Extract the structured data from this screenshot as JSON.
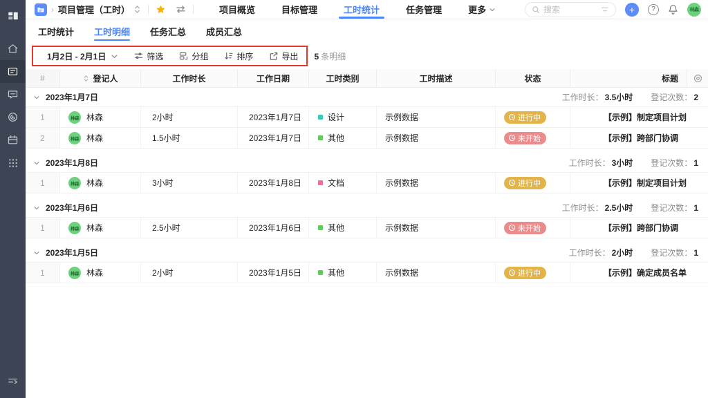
{
  "colors": {
    "accent_blue": "#4a86f8",
    "sidebar_bg": "#3d4554",
    "annotation_red": "#e6392e",
    "status_in_progress": "#e3b448",
    "status_not_started": "#ec8b8b",
    "category_design": "#41c8b4",
    "category_other": "#60c960",
    "category_doc": "#ee6fa4",
    "avatar_green": "#6ed17e",
    "star_yellow": "#f7b500"
  },
  "header": {
    "project_title": "项目管理（工时）",
    "nav": [
      {
        "label": "项目概览"
      },
      {
        "label": "目标管理"
      },
      {
        "label": "工时统计"
      },
      {
        "label": "任务管理"
      },
      {
        "label": "更多"
      }
    ],
    "search": {
      "placeholder": "搜索"
    },
    "plus_label": "+",
    "help_label": "?",
    "avatar": "林森"
  },
  "tabs": [
    {
      "label": "工时统计"
    },
    {
      "label": "工时明细"
    },
    {
      "label": "任务汇总"
    },
    {
      "label": "成员汇总"
    }
  ],
  "toolbar": {
    "date_range": "1月2日 - 2月1日",
    "filter_label": "筛选",
    "group_label": "分组",
    "sort_label": "排序",
    "export_label": "导出",
    "count": "5",
    "count_suffix": "条明细"
  },
  "table": {
    "columns": [
      "#",
      "登记人",
      "工作时长",
      "工作日期",
      "工时类别",
      "工时描述",
      "状态",
      "标题"
    ],
    "summary": {
      "duration_label": "工作时长：",
      "count_label": "登记次数："
    },
    "groups": [
      {
        "date": "2023年1月7日",
        "duration_total": "3.5小时",
        "entry_count": "2",
        "rows": [
          {
            "index": "1",
            "person": "林森",
            "duration": "2小时",
            "date": "2023年1月7日",
            "category": "设计",
            "category_color": "#41c8b4",
            "description": "示例数据",
            "status": "进行中",
            "status_color": "#e3b448",
            "title": "【示例】制定项目计划"
          },
          {
            "index": "2",
            "person": "林森",
            "duration": "1.5小时",
            "date": "2023年1月7日",
            "category": "其他",
            "category_color": "#60c960",
            "description": "示例数据",
            "status": "未开始",
            "status_color": "#ec8b8b",
            "title": "【示例】跨部门协调"
          }
        ]
      },
      {
        "date": "2023年1月8日",
        "duration_total": "3小时",
        "entry_count": "1",
        "rows": [
          {
            "index": "1",
            "person": "林森",
            "duration": "3小时",
            "date": "2023年1月8日",
            "category": "文档",
            "category_color": "#ee6fa4",
            "description": "示例数据",
            "status": "进行中",
            "status_color": "#e3b448",
            "title": "【示例】制定项目计划"
          }
        ]
      },
      {
        "date": "2023年1月6日",
        "duration_total": "2.5小时",
        "entry_count": "1",
        "rows": [
          {
            "index": "1",
            "person": "林森",
            "duration": "2.5小时",
            "date": "2023年1月6日",
            "category": "其他",
            "category_color": "#60c960",
            "description": "示例数据",
            "status": "未开始",
            "status_color": "#ec8b8b",
            "title": "【示例】跨部门协调"
          }
        ]
      },
      {
        "date": "2023年1月5日",
        "duration_total": "2小时",
        "entry_count": "1",
        "rows": [
          {
            "index": "1",
            "person": "林森",
            "duration": "2小时",
            "date": "2023年1月5日",
            "category": "其他",
            "category_color": "#60c960",
            "description": "示例数据",
            "status": "进行中",
            "status_color": "#e3b448",
            "title": "【示例】确定成员名单"
          }
        ]
      }
    ]
  }
}
